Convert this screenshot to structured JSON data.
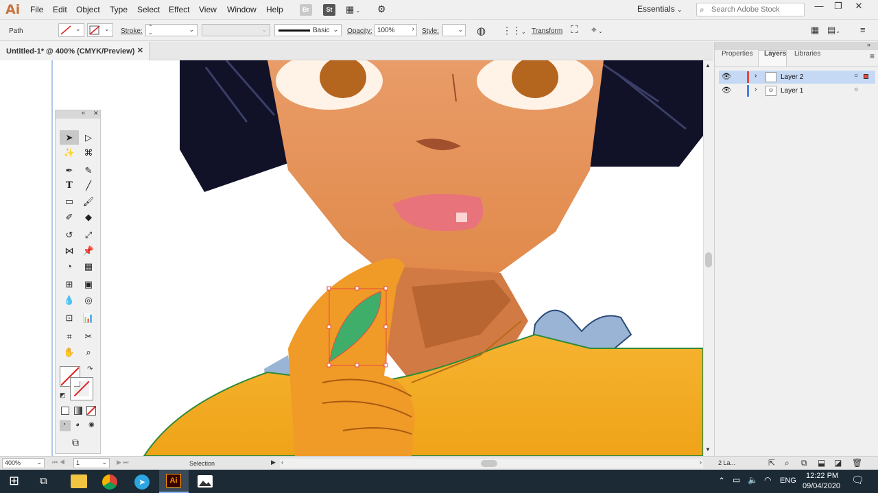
{
  "app": {
    "logo": "Ai"
  },
  "menu": [
    "File",
    "Edit",
    "Object",
    "Type",
    "Select",
    "Effect",
    "View",
    "Window",
    "Help"
  ],
  "toolbar_icons": {
    "bridge": "Br",
    "stock": "St"
  },
  "workspace": {
    "label": "Essentials"
  },
  "search": {
    "placeholder": "Search Adobe Stock"
  },
  "control": {
    "selection_type": "Path",
    "stroke_label": "Stroke:",
    "brush_label": "Basic",
    "opacity_label": "Opacity:",
    "opacity_value": "100%",
    "style_label": "Style:",
    "transform_label": "Transform"
  },
  "doc_tab": {
    "title": "Untitled-1* @ 400% (CMYK/Preview)"
  },
  "panel": {
    "tabs": [
      "Properties",
      "Layers",
      "Libraries"
    ],
    "layers": [
      {
        "name": "Layer 2",
        "color": "#e8493f",
        "selected": true
      },
      {
        "name": "Layer 1",
        "color": "#4a7fe0",
        "selected": false
      }
    ],
    "footer_count": "2 La..."
  },
  "status": {
    "zoom": "400%",
    "artboard": "1",
    "tool": "Selection"
  },
  "taskbar": {
    "lang": "ENG",
    "time": "12:22 PM",
    "date": "09/04/2020",
    "ai_label": "Ai"
  },
  "colors": {
    "accent": "#2d8ceb",
    "ai_brand": "#ff9a00",
    "selection": "#e8493f"
  }
}
